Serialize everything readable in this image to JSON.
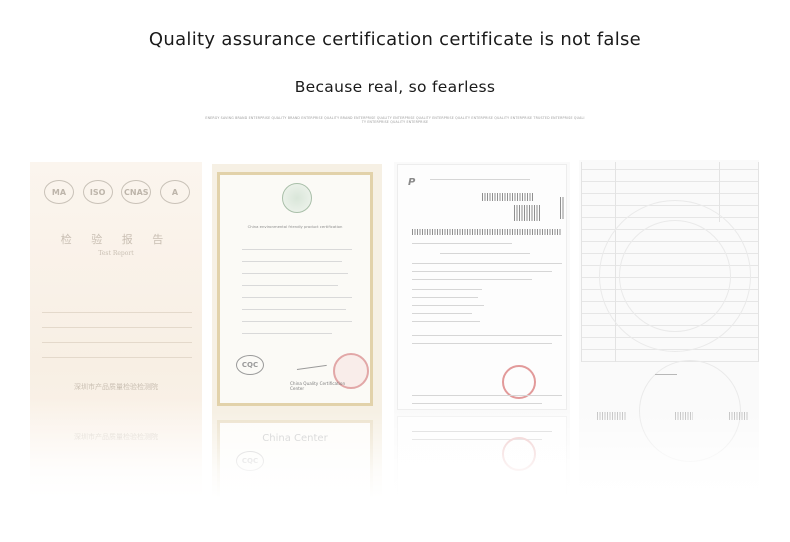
{
  "header": {
    "title": "Quality assurance certification certificate is not false",
    "subtitle": "Because real, so fearless",
    "fine_print": "ENERGY SAVING BRAND ENTERPRISE QUALITY BRAND ENTERPRISE QUALITY BRAND ENTERPRISE QUALITY ENTERPRISE QUALITY ENTERPRISE QUALITY ENTERPRISE QUALITY ENTERPRISE TRUSTED ENTERPRISE QUALITY ENTERPRISE QUALITY ENTERPRISE"
  },
  "certificates": {
    "test_report": {
      "logos": [
        "MA",
        "ISO",
        "CNAS",
        "A"
      ],
      "title": "检 验 报 告",
      "subtitle": "Test Report",
      "bottom_org": "深圳市产品质量检验检测院",
      "reflection_org": "深圳市产品质量检验检测院"
    },
    "environment_cert": {
      "english_title": "China environmental friendly product certification",
      "ccc": "CQC",
      "cqc_line1": "China Quality Certification",
      "cqc_line2": "Center",
      "reflection": "China Center"
    },
    "patent_cert": {
      "logo": "P"
    },
    "grid_cert": {}
  },
  "colors": {
    "heading": "#1a1a1a",
    "seal_red": "#e29a9a",
    "frame_gold": "#e2d2aa"
  }
}
